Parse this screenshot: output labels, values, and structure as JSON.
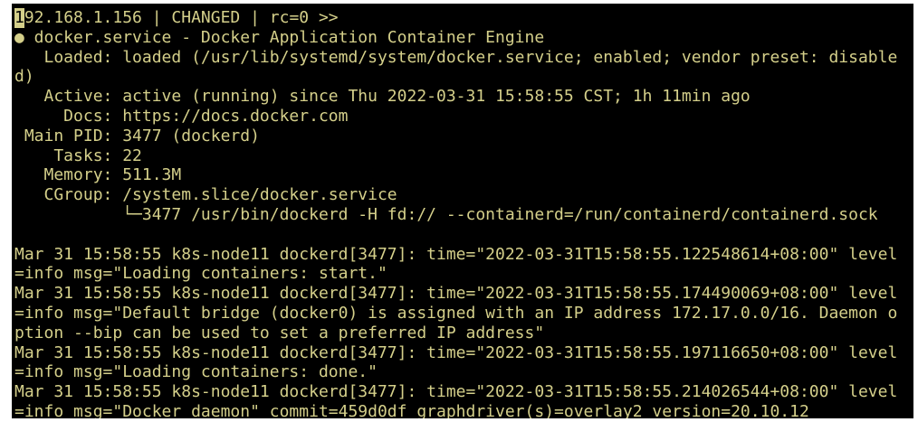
{
  "window": {
    "title": ""
  },
  "terminal": {
    "header_cursor_char": "1",
    "header_rest": "92.168.1.156 | CHANGED | rc=0 >>",
    "lines": [
      "● docker.service - Docker Application Container Engine",
      "   Loaded: loaded (/usr/lib/systemd/system/docker.service; enabled; vendor preset: disable",
      "d)",
      "   Active: active (running) since Thu 2022-03-31 15:58:55 CST; 1h 11min ago",
      "     Docs: https://docs.docker.com",
      " Main PID: 3477 (dockerd)",
      "    Tasks: 22",
      "   Memory: 511.3M",
      "   CGroup: /system.slice/docker.service",
      "           └─3477 /usr/bin/dockerd -H fd:// --containerd=/run/containerd/containerd.sock",
      "",
      "Mar 31 15:58:55 k8s-node11 dockerd[3477]: time=\"2022-03-31T15:58:55.122548614+08:00\" level",
      "=info msg=\"Loading containers: start.\"",
      "Mar 31 15:58:55 k8s-node11 dockerd[3477]: time=\"2022-03-31T15:58:55.174490069+08:00\" level",
      "=info msg=\"Default bridge (docker0) is assigned with an IP address 172.17.0.0/16. Daemon o",
      "ption --bip can be used to set a preferred IP address\"",
      "Mar 31 15:58:55 k8s-node11 dockerd[3477]: time=\"2022-03-31T15:58:55.197116650+08:00\" level",
      "=info msg=\"Loading containers: done.\"",
      "Mar 31 15:58:55 k8s-node11 dockerd[3477]: time=\"2022-03-31T15:58:55.214026544+08:00\" level",
      "=info msg=\"Docker daemon\" commit=459d0df graphdriver(s)=overlay2 version=20.10.12"
    ]
  },
  "colors": {
    "background": "#000000",
    "text": "#d4cf8a"
  }
}
